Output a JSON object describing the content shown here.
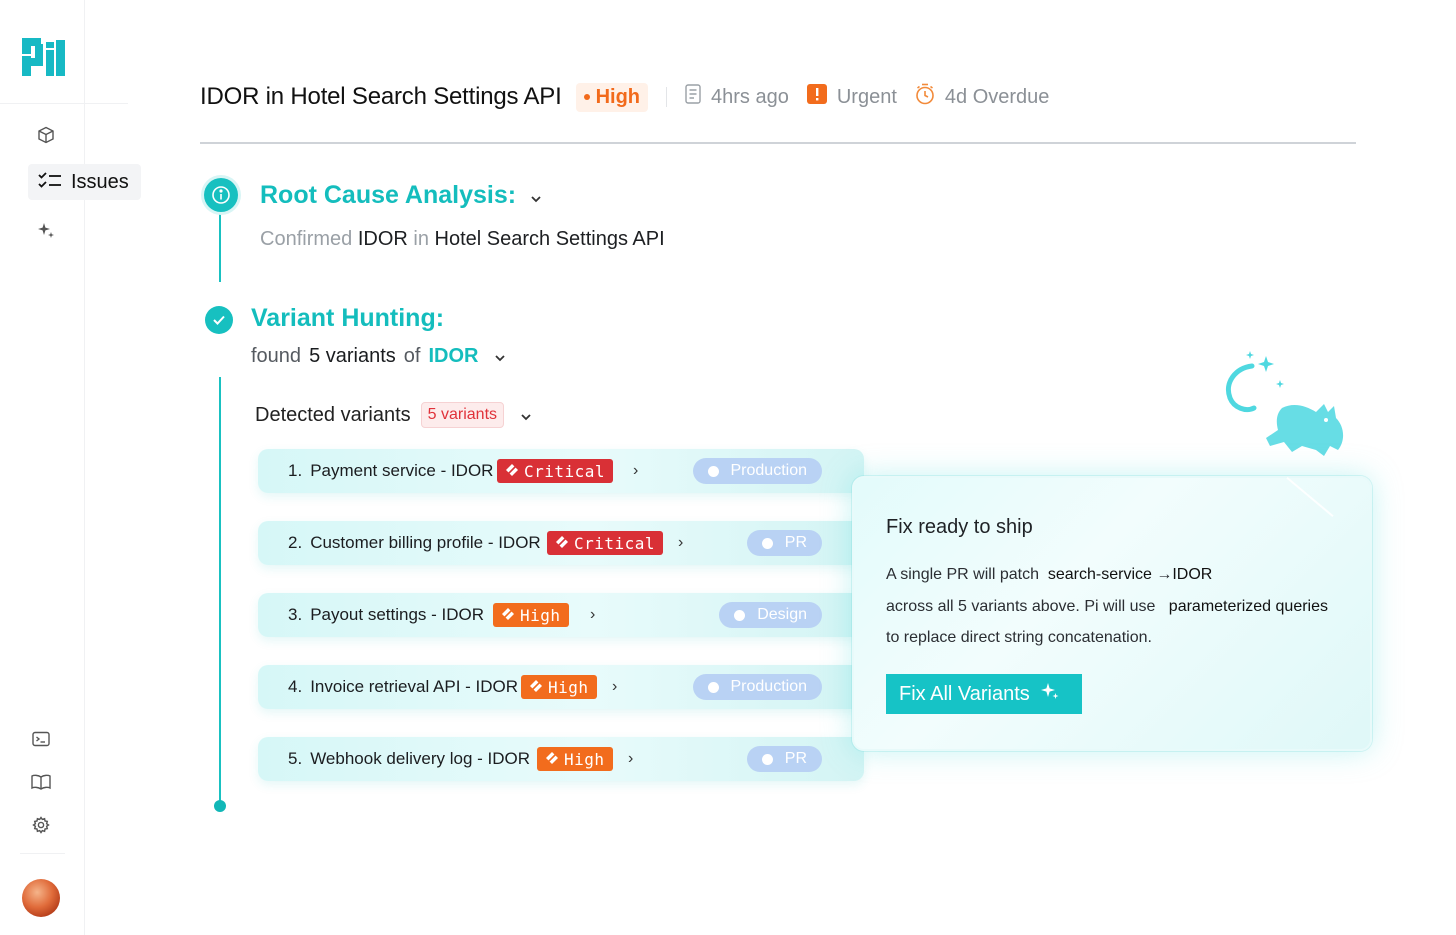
{
  "sidebar": {
    "logo_icon": "pi-logo",
    "items": [
      {
        "icon": "cube-icon"
      },
      {
        "icon": "checklist-icon",
        "label": "Issues",
        "active": true
      },
      {
        "icon": "sparkle-icon"
      }
    ],
    "bottom": [
      {
        "icon": "terminal-icon"
      },
      {
        "icon": "book-icon"
      },
      {
        "icon": "gear-icon"
      }
    ],
    "avatar": "user-avatar"
  },
  "header": {
    "title": "IDOR in Hotel Search Settings API",
    "severity": "High",
    "time": "4hrs ago",
    "priority": "Urgent",
    "due": "4d Overdue"
  },
  "rca": {
    "title": "Root Cause Analysis:",
    "prefix": "Confirmed",
    "vuln": "IDOR",
    "in": "in",
    "target": "Hotel Search Settings API"
  },
  "variant_hunting": {
    "title": "Variant Hunting:",
    "found": "found",
    "count": "5 variants",
    "of": "of",
    "type": "IDOR"
  },
  "detected": {
    "label": "Detected variants",
    "badge": "5 variants"
  },
  "variants": [
    {
      "num": "1.",
      "name": "Payment service - IDOR",
      "severity": "Critical",
      "env": "Production"
    },
    {
      "num": "2.",
      "name": "Customer billing profile - IDOR",
      "severity": "Critical",
      "env": "PR"
    },
    {
      "num": "3.",
      "name": "Payout settings - IDOR",
      "severity": "High",
      "env": "Design"
    },
    {
      "num": "4.",
      "name": "Invoice retrieval API - IDOR",
      "severity": "High",
      "env": "Production"
    },
    {
      "num": "5.",
      "name": "Webhook delivery log - IDOR",
      "severity": "High",
      "env": "PR"
    }
  ],
  "card": {
    "title": "Fix ready to ship",
    "line1a": "A single PR will patch",
    "line1b": "search-service",
    "line1c": "IDOR",
    "line2a": "across all 5 variants  above. Pi will use",
    "line2b": "parameterized queries",
    "line3": "to replace direct string concatenation.",
    "button": "Fix All Variants"
  },
  "colors": {
    "accent": "#14bdbd",
    "high": "#f26c1d",
    "critical": "#d93036",
    "env_pill": "#b9d2f4"
  }
}
